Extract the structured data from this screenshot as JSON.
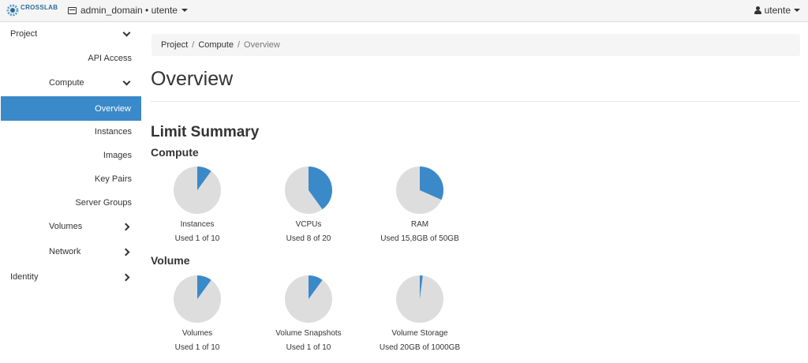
{
  "topbar": {
    "logo_text": "CROSSLAB",
    "domain_label": "admin_domain • utente",
    "user_label": "utente"
  },
  "sidebar": {
    "project": "Project",
    "api_access": "API Access",
    "compute": "Compute",
    "overview": "Overview",
    "instances": "Instances",
    "images": "Images",
    "key_pairs": "Key Pairs",
    "server_groups": "Server Groups",
    "volumes": "Volumes",
    "network": "Network",
    "identity": "Identity"
  },
  "breadcrumb": {
    "project": "Project",
    "compute": "Compute",
    "current": "Overview",
    "separator": "/"
  },
  "page_title": "Overview",
  "limit_summary": "Limit Summary",
  "colors": {
    "used": "#3a89c9",
    "free": "#dddddd",
    "active_nav": "#3a89c9"
  },
  "sections": [
    {
      "title": "Compute",
      "charts": [
        {
          "name": "Instances",
          "used_text": "Used 1 of 10",
          "fraction": 0.1
        },
        {
          "name": "VCPUs",
          "used_text": "Used 8 of 20",
          "fraction": 0.4
        },
        {
          "name": "RAM",
          "used_text": "Used 15,8GB of 50GB",
          "fraction": 0.316
        }
      ]
    },
    {
      "title": "Volume",
      "charts": [
        {
          "name": "Volumes",
          "used_text": "Used 1 of 10",
          "fraction": 0.1
        },
        {
          "name": "Volume Snapshots",
          "used_text": "Used 1 of 10",
          "fraction": 0.1
        },
        {
          "name": "Volume Storage",
          "used_text": "Used 20GB of 1000GB",
          "fraction": 0.02
        }
      ]
    }
  ]
}
